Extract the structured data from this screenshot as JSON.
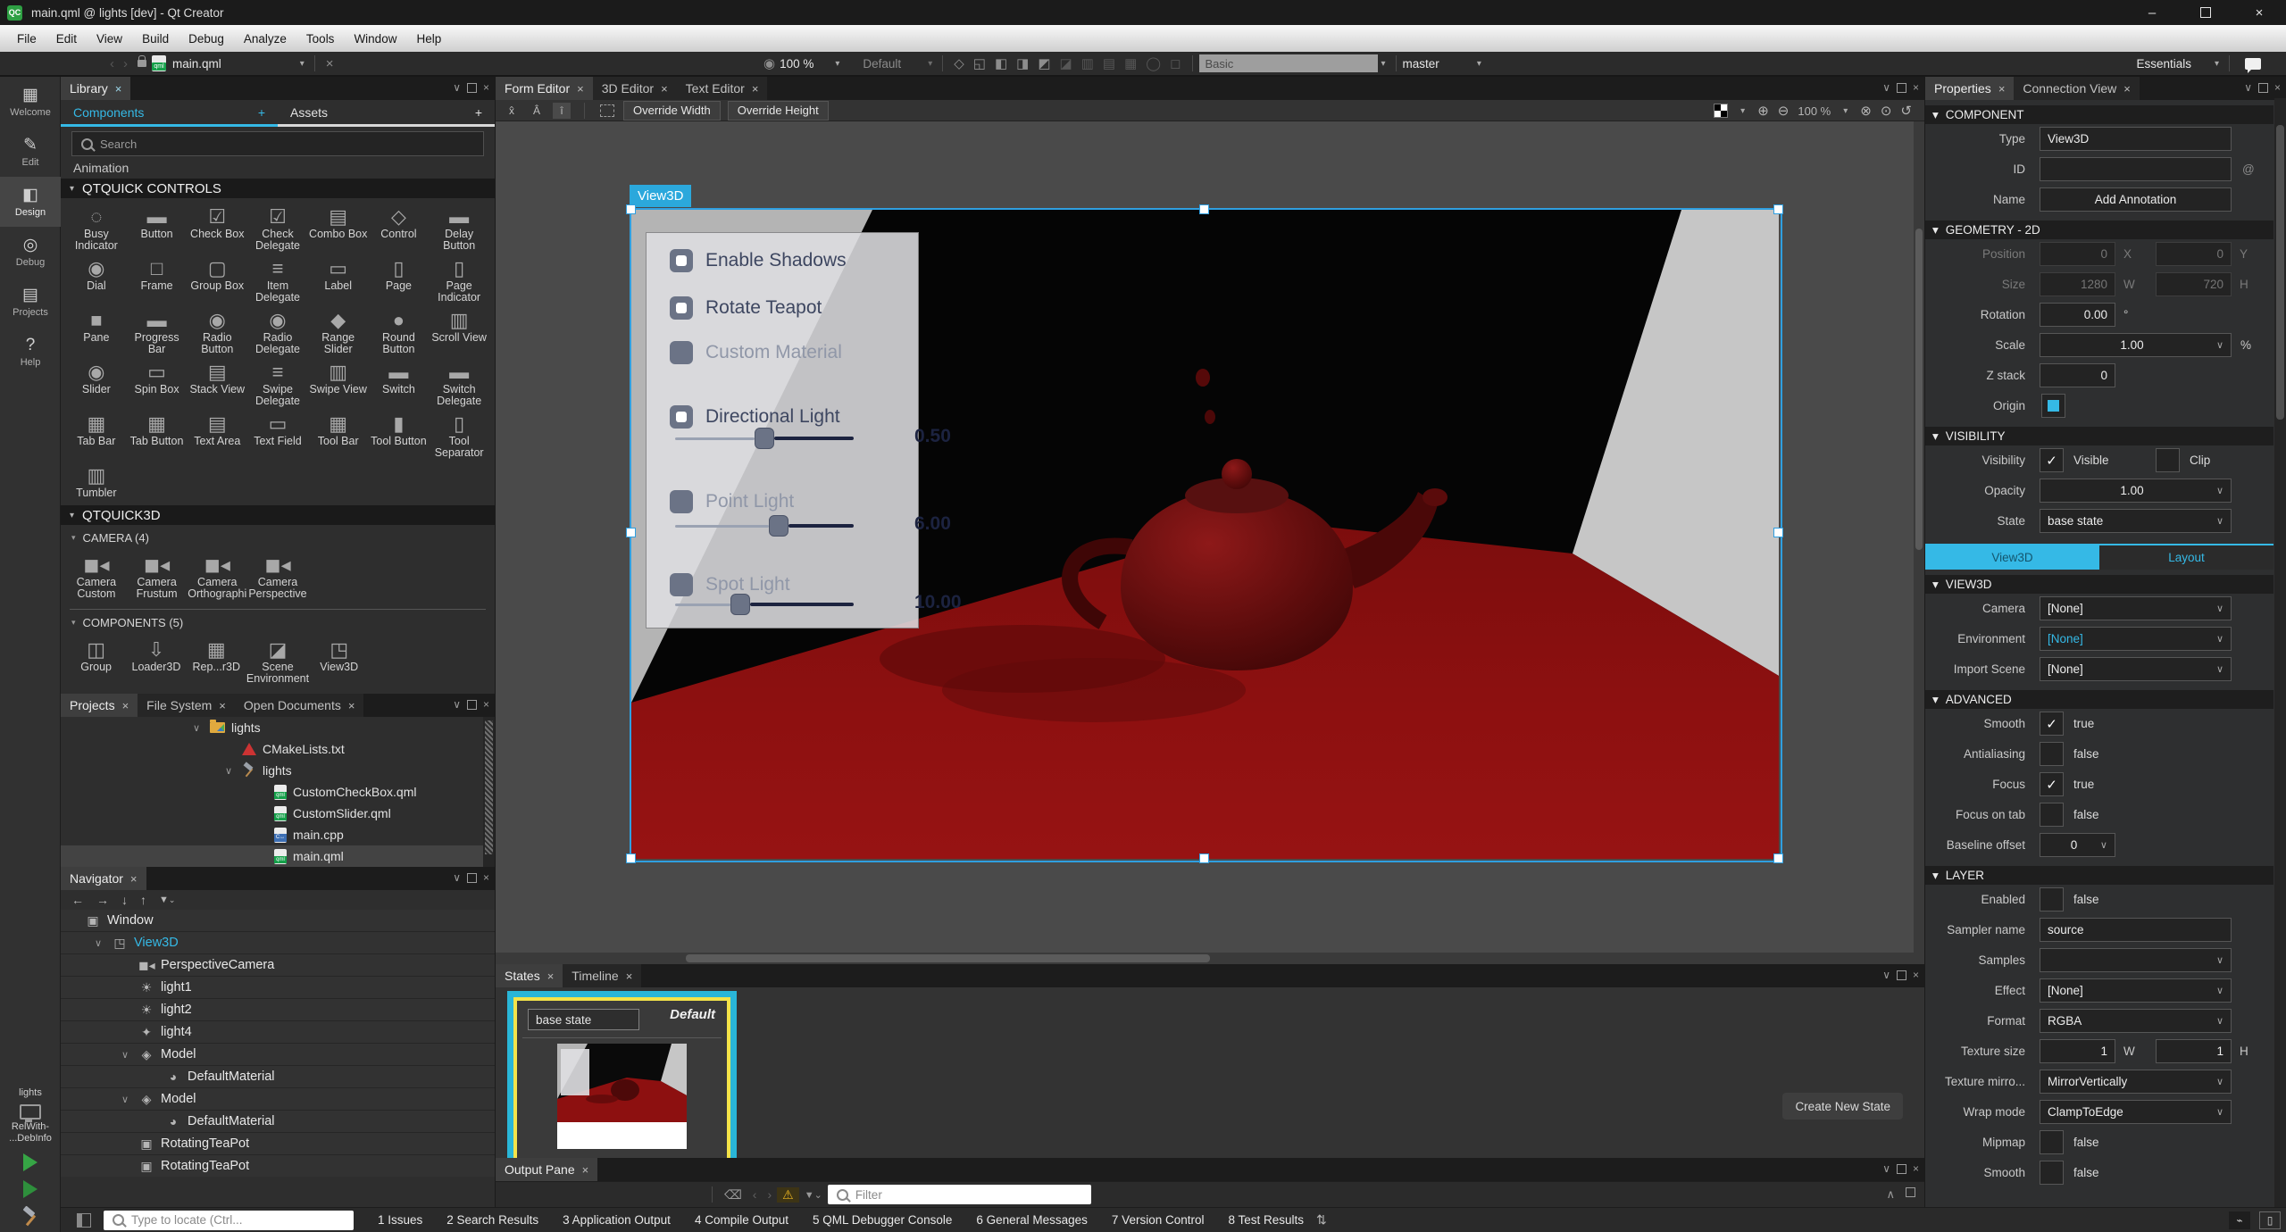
{
  "window": {
    "title": "main.qml @ lights [dev] - Qt Creator",
    "app_badge": "QC"
  },
  "menubar": {
    "items": [
      "File",
      "Edit",
      "View",
      "Build",
      "Debug",
      "Analyze",
      "Tools",
      "Window",
      "Help"
    ]
  },
  "toolbar": {
    "document": "main.qml",
    "zoom": "100 %",
    "style_selector": "Default",
    "search_value": "Basic",
    "branch": "master",
    "perspective": "Essentials",
    "icons": [
      "target-icon",
      "move-icon",
      "resize-icon",
      "anchor-icon",
      "parent-icon",
      "group-icon",
      "ungroup-icon",
      "list-icon",
      "columns-icon",
      "grid-icon",
      "pen-icon",
      "shape-icon"
    ]
  },
  "mode_rail": {
    "items": [
      {
        "label": "Welcome",
        "glyph": "▦"
      },
      {
        "label": "Edit",
        "glyph": "✎"
      },
      {
        "label": "Design",
        "glyph": "◧"
      },
      {
        "label": "Debug",
        "glyph": "◎"
      },
      {
        "label": "Projects",
        "glyph": "▤"
      },
      {
        "label": "Help",
        "glyph": "?"
      }
    ],
    "active": "Design",
    "project_name": "lights",
    "kit_lines": [
      "RelWith-",
      "...DebInfo"
    ]
  },
  "library": {
    "panel_tab": "Library",
    "tabs": {
      "components": "Components",
      "assets": "Assets",
      "add": "+"
    },
    "search_placeholder": "Search",
    "clipped_item": "Animation",
    "controls_header": "QTQUICK CONTROLS",
    "controls": [
      {
        "label": "Busy Indicator",
        "glyph": "◌"
      },
      {
        "label": "Button",
        "glyph": "▬"
      },
      {
        "label": "Check Box",
        "glyph": "☑"
      },
      {
        "label": "Check Delegate",
        "glyph": "☑"
      },
      {
        "label": "Combo Box",
        "glyph": "▤"
      },
      {
        "label": "Control",
        "glyph": "◇"
      },
      {
        "label": "Delay Button",
        "glyph": "▬"
      },
      {
        "label": "Dial",
        "glyph": "◉"
      },
      {
        "label": "Frame",
        "glyph": "□"
      },
      {
        "label": "Group Box",
        "glyph": "▢"
      },
      {
        "label": "Item Delegate",
        "glyph": "≡"
      },
      {
        "label": "Label",
        "glyph": "▭"
      },
      {
        "label": "Page",
        "glyph": "▯"
      },
      {
        "label": "Page Indicator",
        "glyph": "▯"
      },
      {
        "label": "Pane",
        "glyph": "■"
      },
      {
        "label": "Progress Bar",
        "glyph": "▬"
      },
      {
        "label": "Radio Button",
        "glyph": "◉"
      },
      {
        "label": "Radio Delegate",
        "glyph": "◉"
      },
      {
        "label": "Range Slider",
        "glyph": "◆"
      },
      {
        "label": "Round Button",
        "glyph": "●"
      },
      {
        "label": "Scroll View",
        "glyph": "▥"
      },
      {
        "label": "Slider",
        "glyph": "◉"
      },
      {
        "label": "Spin Box",
        "glyph": "▭"
      },
      {
        "label": "Stack View",
        "glyph": "▤"
      },
      {
        "label": "Swipe Delegate",
        "glyph": "≡"
      },
      {
        "label": "Swipe View",
        "glyph": "▥"
      },
      {
        "label": "Switch",
        "glyph": "▬"
      },
      {
        "label": "Switch Delegate",
        "glyph": "▬"
      },
      {
        "label": "Tab Bar",
        "glyph": "▦"
      },
      {
        "label": "Tab Button",
        "glyph": "▦"
      },
      {
        "label": "Text Area",
        "glyph": "▤"
      },
      {
        "label": "Text Field",
        "glyph": "▭"
      },
      {
        "label": "Tool Bar",
        "glyph": "▦"
      },
      {
        "label": "Tool Button",
        "glyph": "▮"
      },
      {
        "label": "Tool Separator",
        "glyph": "▯"
      },
      {
        "label": "Tumbler",
        "glyph": "▥"
      }
    ],
    "quick3d_header": "QTQUICK3D",
    "camera_header": "CAMERA (4)",
    "cameras": [
      {
        "label": "Camera Custom",
        "glyph": "◼◂"
      },
      {
        "label": "Camera Frustum",
        "glyph": "◼◂"
      },
      {
        "label": "Camera Orthographi",
        "glyph": "◼◂"
      },
      {
        "label": "Camera Perspective",
        "glyph": "◼◂"
      }
    ],
    "components_header": "COMPONENTS (5)",
    "components": [
      {
        "label": "Group",
        "glyph": "◫"
      },
      {
        "label": "Loader3D",
        "glyph": "⇩"
      },
      {
        "label": "Rep...r3D",
        "glyph": "▦"
      },
      {
        "label": "Scene Environment",
        "glyph": "◪"
      },
      {
        "label": "View3D",
        "glyph": "◳"
      }
    ]
  },
  "projects_panel": {
    "tabs": [
      "Projects",
      "File System",
      "Open Documents"
    ],
    "active_tab": "Projects",
    "tree": [
      {
        "depth": 0,
        "icon": "folder",
        "label": "lights",
        "caret": true
      },
      {
        "depth": 1,
        "icon": "cmake",
        "label": "CMakeLists.txt"
      },
      {
        "depth": 1,
        "icon": "hammer",
        "label": "lights",
        "caret": true
      },
      {
        "depth": 2,
        "icon": "qml",
        "label": "CustomCheckBox.qml"
      },
      {
        "depth": 2,
        "icon": "qml",
        "label": "CustomSlider.qml"
      },
      {
        "depth": 2,
        "icon": "cpp",
        "label": "main.cpp"
      },
      {
        "depth": 2,
        "icon": "qml",
        "label": "main.qml",
        "selected": true
      }
    ]
  },
  "navigator": {
    "panel_tab": "Navigator",
    "tree": [
      {
        "depth": 0,
        "icon": "chip",
        "label": "Window"
      },
      {
        "depth": 1,
        "icon": "clapper",
        "label": "View3D",
        "accent": true,
        "caret": true
      },
      {
        "depth": 2,
        "icon": "camera",
        "label": "PerspectiveCamera"
      },
      {
        "depth": 2,
        "icon": "sun",
        "label": "light1"
      },
      {
        "depth": 2,
        "icon": "sun",
        "label": "light2"
      },
      {
        "depth": 2,
        "icon": "point",
        "label": "light4"
      },
      {
        "depth": 2,
        "icon": "cube",
        "label": "Model",
        "caret": true
      },
      {
        "depth": 3,
        "icon": "sphere",
        "label": "DefaultMaterial"
      },
      {
        "depth": 2,
        "icon": "cube",
        "label": "Model",
        "caret": true
      },
      {
        "depth": 3,
        "icon": "sphere",
        "label": "DefaultMaterial"
      },
      {
        "depth": 2,
        "icon": "chip",
        "label": "RotatingTeaPot"
      },
      {
        "depth": 2,
        "icon": "chip",
        "label": "RotatingTeaPot"
      }
    ]
  },
  "form_editor": {
    "tabs": [
      "Form Editor",
      "3D Editor",
      "Text Editor"
    ],
    "active_tab": "Form Editor",
    "override_width": "Override Width",
    "override_height": "Override Height",
    "zoom": "100 %",
    "selection_tag": "View3D"
  },
  "viewport": {
    "overlay": {
      "rows": [
        {
          "label": "Enable Shadows",
          "enabled": true
        },
        {
          "label": "Rotate Teapot",
          "enabled": true
        },
        {
          "label": "Custom Material",
          "enabled": false
        },
        {
          "label": "Directional Light",
          "enabled": true,
          "slider": {
            "value": "0.50",
            "pos": 50
          }
        },
        {
          "label": "Point Light",
          "enabled": false,
          "slider": {
            "value": "6.00",
            "pos": 59
          }
        },
        {
          "label": "Spot Light",
          "enabled": false,
          "slider": {
            "value": "10.00",
            "pos": 35
          }
        }
      ]
    }
  },
  "states_panel": {
    "tabs": [
      "States",
      "Timeline"
    ],
    "active_tab": "States",
    "state_name": "base state",
    "state_badge": "Default",
    "create_button": "Create New State"
  },
  "output_pane": {
    "tab": "Output Pane",
    "filter_placeholder": "Filter"
  },
  "properties": {
    "tabs": [
      "Properties",
      "Connection View"
    ],
    "active_tab": "Properties",
    "sections": [
      {
        "header": "COMPONENT",
        "rows": [
          {
            "type": "text",
            "label": "Type",
            "value": "View3D"
          },
          {
            "type": "text",
            "label": "ID",
            "value": "",
            "trail": "@"
          },
          {
            "type": "button",
            "label": "Name",
            "value": "Add Annotation"
          }
        ]
      },
      {
        "header": "GEOMETRY - 2D",
        "rows": [
          {
            "type": "pair",
            "label": "Position",
            "v1": "0",
            "u1": "X",
            "v2": "0",
            "u2": "Y",
            "disabled": true
          },
          {
            "type": "pair",
            "label": "Size",
            "v1": "1280",
            "u1": "W",
            "v2": "720",
            "u2": "H",
            "disabled": true
          },
          {
            "type": "small",
            "label": "Rotation",
            "value": "0.00",
            "suffix": "°"
          },
          {
            "type": "dropwide",
            "label": "Scale",
            "value": "1.00",
            "suffix": "%"
          },
          {
            "type": "small",
            "label": "Z stack",
            "value": "0"
          },
          {
            "type": "origin",
            "label": "Origin"
          }
        ]
      },
      {
        "header": "VISIBILITY",
        "rows": [
          {
            "type": "check2",
            "label": "Visibility",
            "c1": true,
            "t1": "Visible",
            "c2": false,
            "t2": "Clip"
          },
          {
            "type": "dropwide",
            "label": "Opacity",
            "value": "1.00"
          },
          {
            "type": "dropdown",
            "label": "State",
            "value": "base state"
          }
        ]
      },
      {
        "tabs": {
          "left": "View3D",
          "right": "Layout",
          "active": "left"
        }
      },
      {
        "header": "VIEW3D",
        "rows": [
          {
            "type": "dropdown",
            "label": "Camera",
            "value": "[None]"
          },
          {
            "type": "dropdown",
            "label": "Environment",
            "value": "[None]",
            "accent": true
          },
          {
            "type": "dropdown",
            "label": "Import Scene",
            "value": "[None]"
          }
        ]
      },
      {
        "header": "ADVANCED",
        "rows": [
          {
            "type": "check",
            "label": "Smooth",
            "checked": true,
            "text": "true"
          },
          {
            "type": "check",
            "label": "Antialiasing",
            "checked": false,
            "text": "false"
          },
          {
            "type": "check",
            "label": "Focus",
            "checked": true,
            "text": "true"
          },
          {
            "type": "check",
            "label": "Focus on tab",
            "checked": false,
            "text": "false"
          },
          {
            "type": "smalldrop",
            "label": "Baseline offset",
            "value": "0"
          }
        ]
      },
      {
        "header": "LAYER",
        "rows": [
          {
            "type": "check",
            "label": "Enabled",
            "checked": false,
            "text": "false"
          },
          {
            "type": "text",
            "label": "Sampler name",
            "value": "source"
          },
          {
            "type": "dropdown",
            "label": "Samples",
            "value": ""
          },
          {
            "type": "dropdown",
            "label": "Effect",
            "value": "[None]"
          },
          {
            "type": "dropdown",
            "label": "Format",
            "value": "RGBA"
          },
          {
            "type": "pair",
            "label": "Texture size",
            "v1": "1",
            "u1": "W",
            "v2": "1",
            "u2": "H"
          },
          {
            "type": "dropdown",
            "label": "Texture mirro...",
            "value": "MirrorVertically"
          },
          {
            "type": "dropdown",
            "label": "Wrap mode",
            "value": "ClampToEdge"
          },
          {
            "type": "check",
            "label": "Mipmap",
            "checked": false,
            "text": "false"
          },
          {
            "type": "check",
            "label": "Smooth",
            "checked": false,
            "text": "false"
          }
        ]
      }
    ]
  },
  "statusbar": {
    "locator_placeholder": "Type to locate (Ctrl...",
    "buttons": [
      "1 Issues",
      "2 Search Results",
      "3 Application Output",
      "4 Compile Output",
      "5 QML Debugger Console",
      "6 General Messages",
      "7 Version Control",
      "8 Test Results"
    ]
  },
  "colors": {
    "accent": "#35b9e6",
    "selection_border": "#2f9fe0",
    "state_border_outer": "#29b6d8",
    "state_border_inner": "#f3e34a",
    "floor_red": "#8d1010",
    "teapot_red": "#4d0909",
    "wall_left": "#b4b4b4",
    "wall_right": "#c6c6c6"
  }
}
